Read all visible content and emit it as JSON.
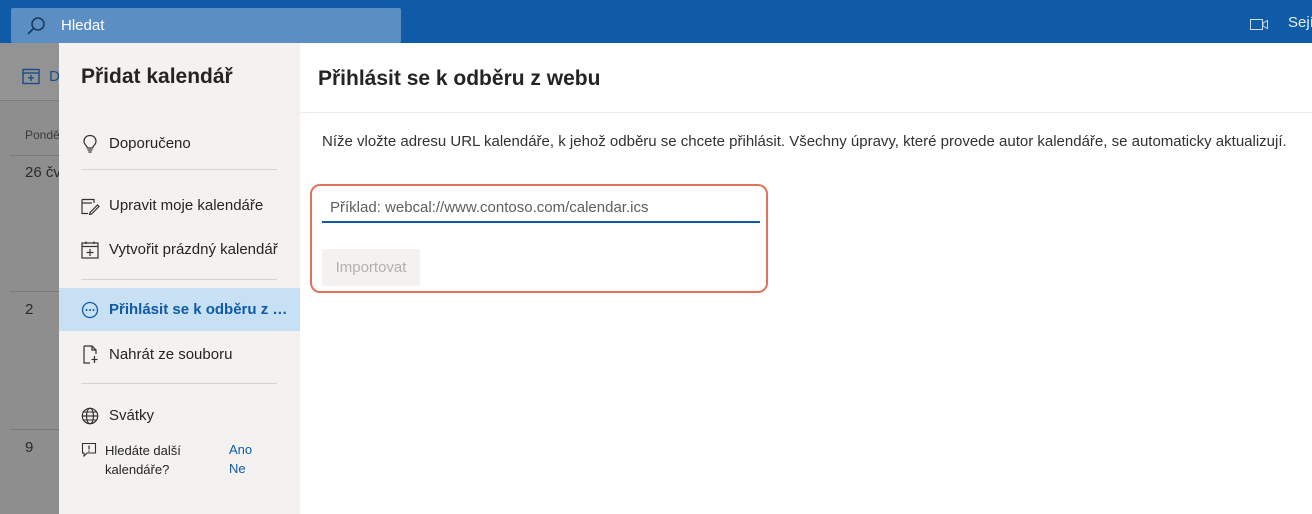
{
  "topbar": {
    "search_placeholder": "Hledat",
    "meet_label": "Sejí"
  },
  "background": {
    "toolbar_label": "D",
    "column_header": "Pondě",
    "week_numbers": [
      "26 čv",
      "2",
      "9"
    ]
  },
  "panel": {
    "title": "Přidat kalendář",
    "items": [
      {
        "label": "Doporučeno",
        "icon": "lightbulb-icon"
      },
      {
        "label": "Upravit moje kalendáře",
        "icon": "edit-calendar-icon"
      },
      {
        "label": "Vytvořit prázdný kalendář",
        "icon": "add-calendar-icon"
      },
      {
        "label": "Přihlásit se k odběru z webu",
        "icon": "subscribe-icon"
      },
      {
        "label": "Nahrát ze souboru",
        "icon": "upload-file-icon"
      },
      {
        "label": "Svátky",
        "icon": "globe-icon"
      }
    ],
    "feedback": {
      "text": "Hledáte další kalendáře?",
      "yes": "Ano",
      "no": "Ne"
    }
  },
  "main": {
    "title": "Přihlásit se k odběru z webu",
    "description": "Níže vložte adresu URL kalendáře, k jehož odběru se chcete přihlásit. Všechny úpravy, které provede autor kalendáře, se automaticky aktualizují.",
    "url_placeholder": "Příklad: webcal://www.contoso.com/calendar.ics",
    "url_value": "",
    "import_label": "Importovat"
  },
  "colors": {
    "accent": "#0f5ba7",
    "active_bg": "#c7e0f4",
    "highlight": "#e0735a"
  }
}
